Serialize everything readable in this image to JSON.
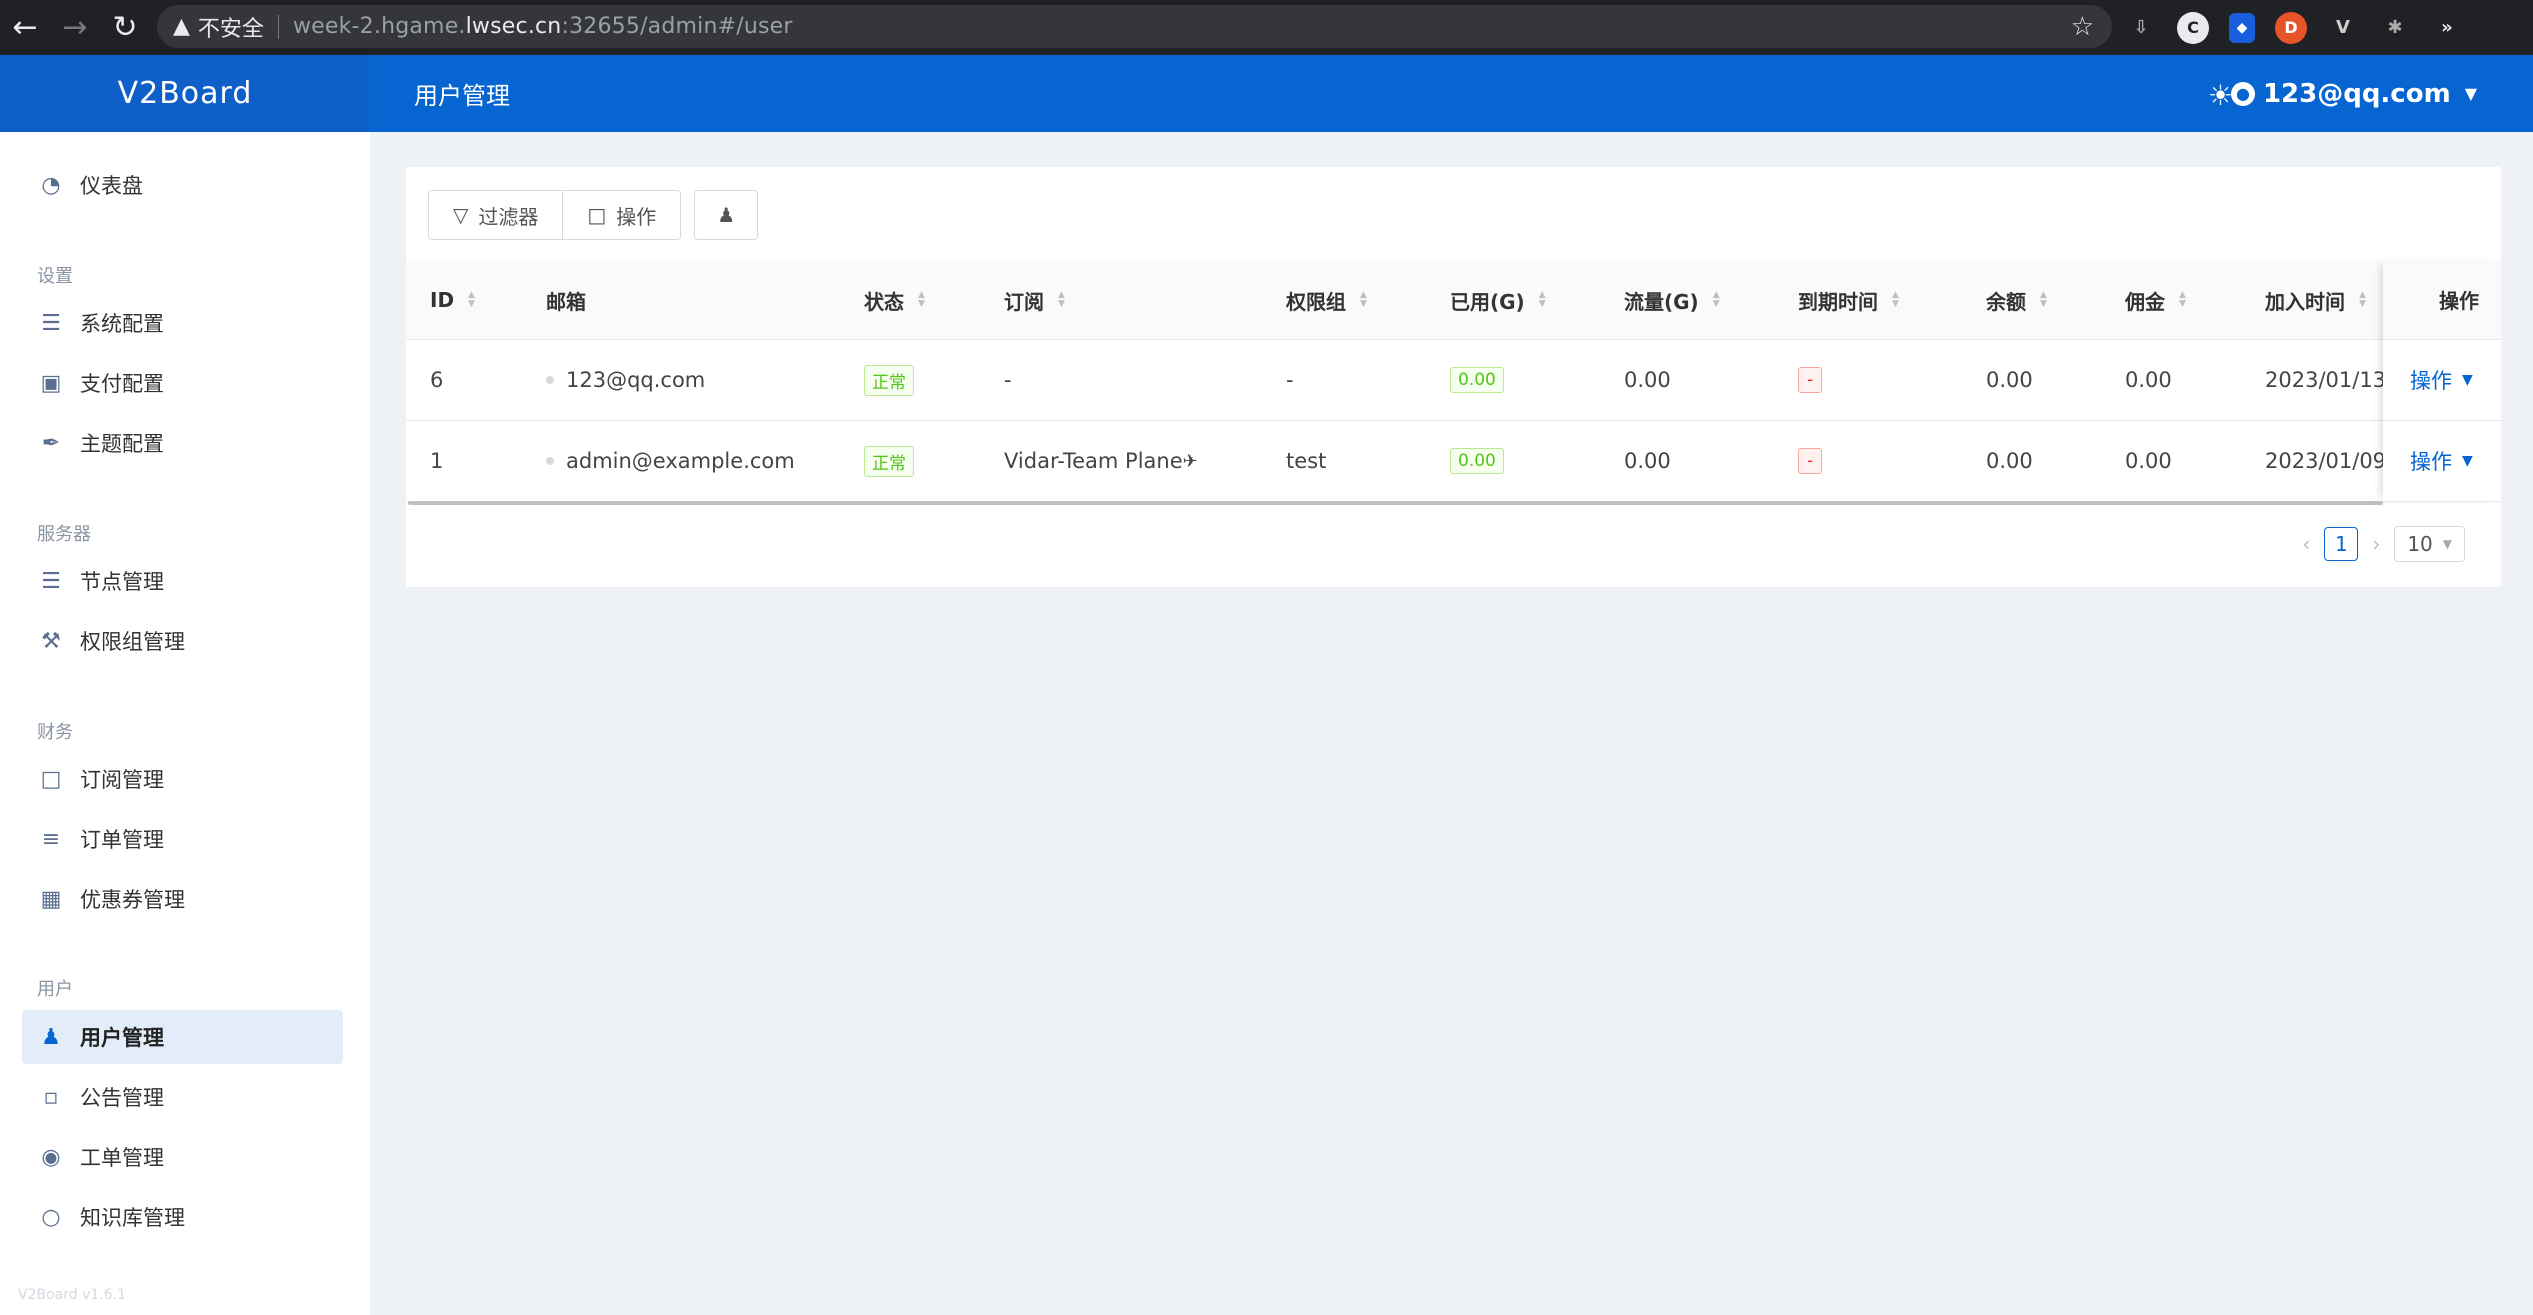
{
  "browser": {
    "insecure_label": "不安全",
    "url_prefix": "week-2.hgame.",
    "url_domain": "lwsec.cn",
    "url_suffix": ":32655/admin#/user"
  },
  "brand": "V2Board",
  "header": {
    "title": "用户管理",
    "user_email": "123@qq.com"
  },
  "sidebar": {
    "dashboard": "仪表盘",
    "groups": [
      {
        "heading": "设置",
        "items": [
          "系统配置",
          "支付配置",
          "主题配置"
        ]
      },
      {
        "heading": "服务器",
        "items": [
          "节点管理",
          "权限组管理"
        ]
      },
      {
        "heading": "财务",
        "items": [
          "订阅管理",
          "订单管理",
          "优惠券管理"
        ]
      },
      {
        "heading": "用户",
        "items": [
          "用户管理",
          "公告管理",
          "工单管理",
          "知识库管理"
        ]
      }
    ],
    "active_item": "用户管理",
    "version": "V2Board v1.6.1"
  },
  "toolbar": {
    "filter_label": "过滤器",
    "action_label": "操作"
  },
  "table": {
    "columns": [
      "ID",
      "邮箱",
      "状态",
      "订阅",
      "权限组",
      "已用(G)",
      "流量(G)",
      "到期时间",
      "余额",
      "佣金",
      "加入时间",
      "操作"
    ],
    "rows": [
      {
        "id": "6",
        "email": "123@qq.com",
        "status": "正常",
        "subscription": "-",
        "group": "-",
        "used": "0.00",
        "traffic": "0.00",
        "expire": "-",
        "balance": "0.00",
        "commission": "0.00",
        "joined": "2023/01/13",
        "action": "操作"
      },
      {
        "id": "1",
        "email": "admin@example.com",
        "status": "正常",
        "subscription": "Vidar-Team Plane",
        "group": "test",
        "used": "0.00",
        "traffic": "0.00",
        "expire": "-",
        "balance": "0.00",
        "commission": "0.00",
        "joined": "2023/01/09",
        "action": "操作"
      }
    ]
  },
  "pagination": {
    "current_page": "1",
    "page_size": "10"
  },
  "colors": {
    "primary": "#0665d0",
    "brand_bg": "#0e5fc7",
    "success": "#52c41a",
    "danger": "#f5222d"
  }
}
